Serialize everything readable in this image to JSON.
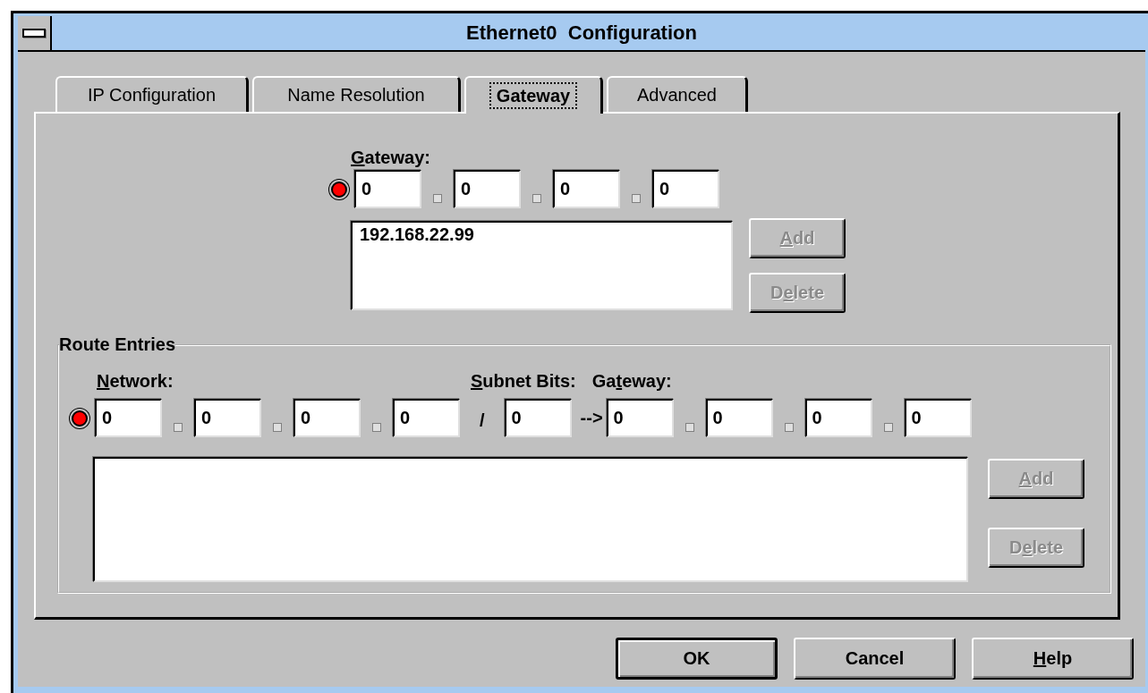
{
  "window": {
    "title": "Ethernet0  Configuration"
  },
  "tabs": [
    {
      "label": "IP Configuration",
      "selected": false
    },
    {
      "label": "Name Resolution",
      "selected": false
    },
    {
      "label": "Gateway",
      "selected": true
    },
    {
      "label": "Advanced",
      "selected": false
    }
  ],
  "gateway": {
    "label": [
      {
        "text": "G",
        "underline": true
      },
      {
        "text": "ateway:",
        "underline": false
      }
    ],
    "selected": true,
    "octets": [
      "0",
      "0",
      "0",
      "0"
    ],
    "list": [
      "192.168.22.99"
    ],
    "buttons": [
      {
        "label": [
          {
            "text": "A",
            "underline": true
          },
          {
            "text": "dd",
            "underline": false
          }
        ],
        "disabled": true
      },
      {
        "label": [
          {
            "text": "D",
            "underline": false
          },
          {
            "text": "e",
            "underline": true
          },
          {
            "text": "lete",
            "underline": false
          }
        ],
        "disabled": true
      }
    ]
  },
  "route_entries": {
    "title": "Route Entries",
    "selected": true,
    "network_label": [
      {
        "text": "N",
        "underline": true
      },
      {
        "text": "etwork:",
        "underline": false
      }
    ],
    "subnet_label": [
      {
        "text": "S",
        "underline": true
      },
      {
        "text": "ubnet Bits:",
        "underline": false
      }
    ],
    "gateway_label": [
      {
        "text": "Ga",
        "underline": false
      },
      {
        "text": "t",
        "underline": true
      },
      {
        "text": "eway:",
        "underline": false
      }
    ],
    "network": [
      "0",
      "0",
      "0",
      "0"
    ],
    "slash": "/",
    "subnet_bits": "0",
    "arrow": "-->",
    "gateway": [
      "0",
      "0",
      "0",
      "0"
    ],
    "buttons": [
      {
        "label": [
          {
            "text": "A",
            "underline": true
          },
          {
            "text": "dd",
            "underline": false
          }
        ],
        "disabled": true
      },
      {
        "label": [
          {
            "text": "D",
            "underline": false
          },
          {
            "text": "e",
            "underline": true
          },
          {
            "text": "lete",
            "underline": false
          }
        ],
        "disabled": true
      }
    ]
  },
  "buttons": [
    {
      "label": [
        {
          "text": "OK",
          "underline": false
        }
      ],
      "default": true,
      "disabled": false
    },
    {
      "label": [
        {
          "text": "Cancel",
          "underline": false
        }
      ],
      "default": false,
      "disabled": false
    },
    {
      "label": [
        {
          "text": "H",
          "underline": true
        },
        {
          "text": "elp",
          "underline": false
        }
      ],
      "default": false,
      "disabled": false
    }
  ]
}
